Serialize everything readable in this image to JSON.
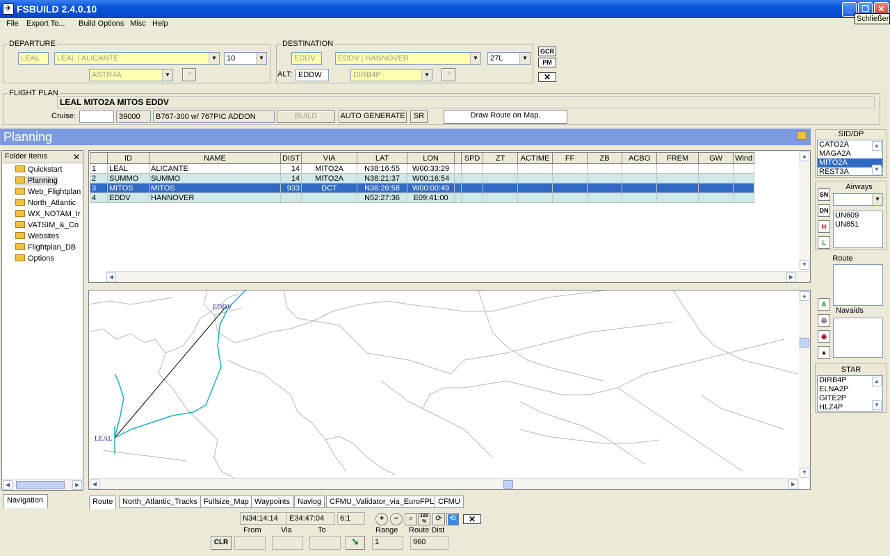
{
  "window": {
    "title": "FSBUILD 2.4.0.10",
    "tooltip": "Schließen"
  },
  "menu": [
    "File",
    "Export To...",
    "Build Options",
    "Misc",
    "Help"
  ],
  "departure": {
    "legend": "DEPARTURE",
    "icao": "LEAL",
    "airport": "LEAL | ALICANTE",
    "runway": "10",
    "sid": "ASTR4A"
  },
  "destination": {
    "legend": "DESTINATION",
    "icao": "EDDV",
    "airport": "EDDV | HANNOVER",
    "runway": "27L",
    "alt_label": "ALT:",
    "alt": "EDDW",
    "star": "DIRB4P"
  },
  "side_buttons": {
    "gcr": "GCR",
    "pm": "PM"
  },
  "flightplan": {
    "legend": "FLIGHT PLAN",
    "route": "LEAL MITO2A MITOS EDDV",
    "cruise_label": "Cruise:",
    "cruise": "",
    "alt": "39000",
    "aircraft": "B767-300 w/ 767PIC ADDON",
    "build": "BUILD",
    "auto": "AUTO GENERATE",
    "sr": "SR",
    "draw": "Draw Route on Map."
  },
  "planning": {
    "title": "Planning"
  },
  "folders": {
    "header": "Folder Items",
    "items": [
      "Quickstart",
      "Planning",
      "Web_Flightplan",
      "North_Atlantic",
      "WX_NOTAM_Ir",
      "VATSIM_&_Co",
      "Websites",
      "Flightplan_DB",
      "Options"
    ],
    "nav_tab": "Navigation"
  },
  "grid": {
    "columns": [
      "",
      "ID",
      "NAME",
      "DIST",
      "VIA",
      "LAT",
      "LON",
      "",
      "SPD",
      "ZT",
      "ACTIME",
      "FF",
      "ZB",
      "ACBO",
      "FREM",
      "GW",
      "Wind"
    ],
    "rows": [
      {
        "n": "1",
        "id": "LEAL",
        "name": "ALICANTE",
        "dist": "14",
        "via": "MITO2A",
        "lat": "N38:16:55",
        "lon": "W00:33:29"
      },
      {
        "n": "2",
        "id": "SUMMO",
        "name": "SUMMO",
        "dist": "14",
        "via": "MITO2A",
        "lat": "N38:21:37",
        "lon": "W00:16:54"
      },
      {
        "n": "3",
        "id": "MITOS",
        "name": "MITOS",
        "dist": "933",
        "via": "DCT",
        "lat": "N38:26:58",
        "lon": "W00:00:49"
      },
      {
        "n": "4",
        "id": "EDDV",
        "name": "HANNOVER",
        "dist": "",
        "via": "",
        "lat": "N52:27:36",
        "lon": "E09:41:00"
      }
    ]
  },
  "map": {
    "labels": [
      "EDDV",
      "LEAL"
    ]
  },
  "tabs": [
    "Route",
    "North_Atlantic_Tracks",
    "Fullsize_Map",
    "Waypoints",
    "Navlog",
    "CFMU_Validator_via_EuroFPL",
    "CFMU"
  ],
  "bottom": {
    "coord_lat": "N34:14:14",
    "coord_lon": "E34:47:04",
    "scale": "6:1",
    "clr": "CLR",
    "from_label": "From",
    "via_label": "Via",
    "to_label": "To",
    "range_label": "Range",
    "range": "1",
    "routedist_label": "Route Dist",
    "routedist": "960",
    "zoom100": "100 %"
  },
  "right": {
    "sid_title": "SID/DP",
    "sids": [
      "CATO2A",
      "MAGA2A",
      "MITO2A",
      "REST3A"
    ],
    "airways_title": "Airways",
    "airways": [
      "UN609",
      "UN851"
    ],
    "route_title": "Route",
    "navaids_title": "Navaids",
    "star_title": "STAR",
    "stars": [
      "DIRB4P",
      "ELNA2P",
      "GITE2P",
      "HLZ4P"
    ],
    "sn": "SN",
    "dn": "DN",
    "h": "H",
    "l": "L",
    "a": "A"
  }
}
